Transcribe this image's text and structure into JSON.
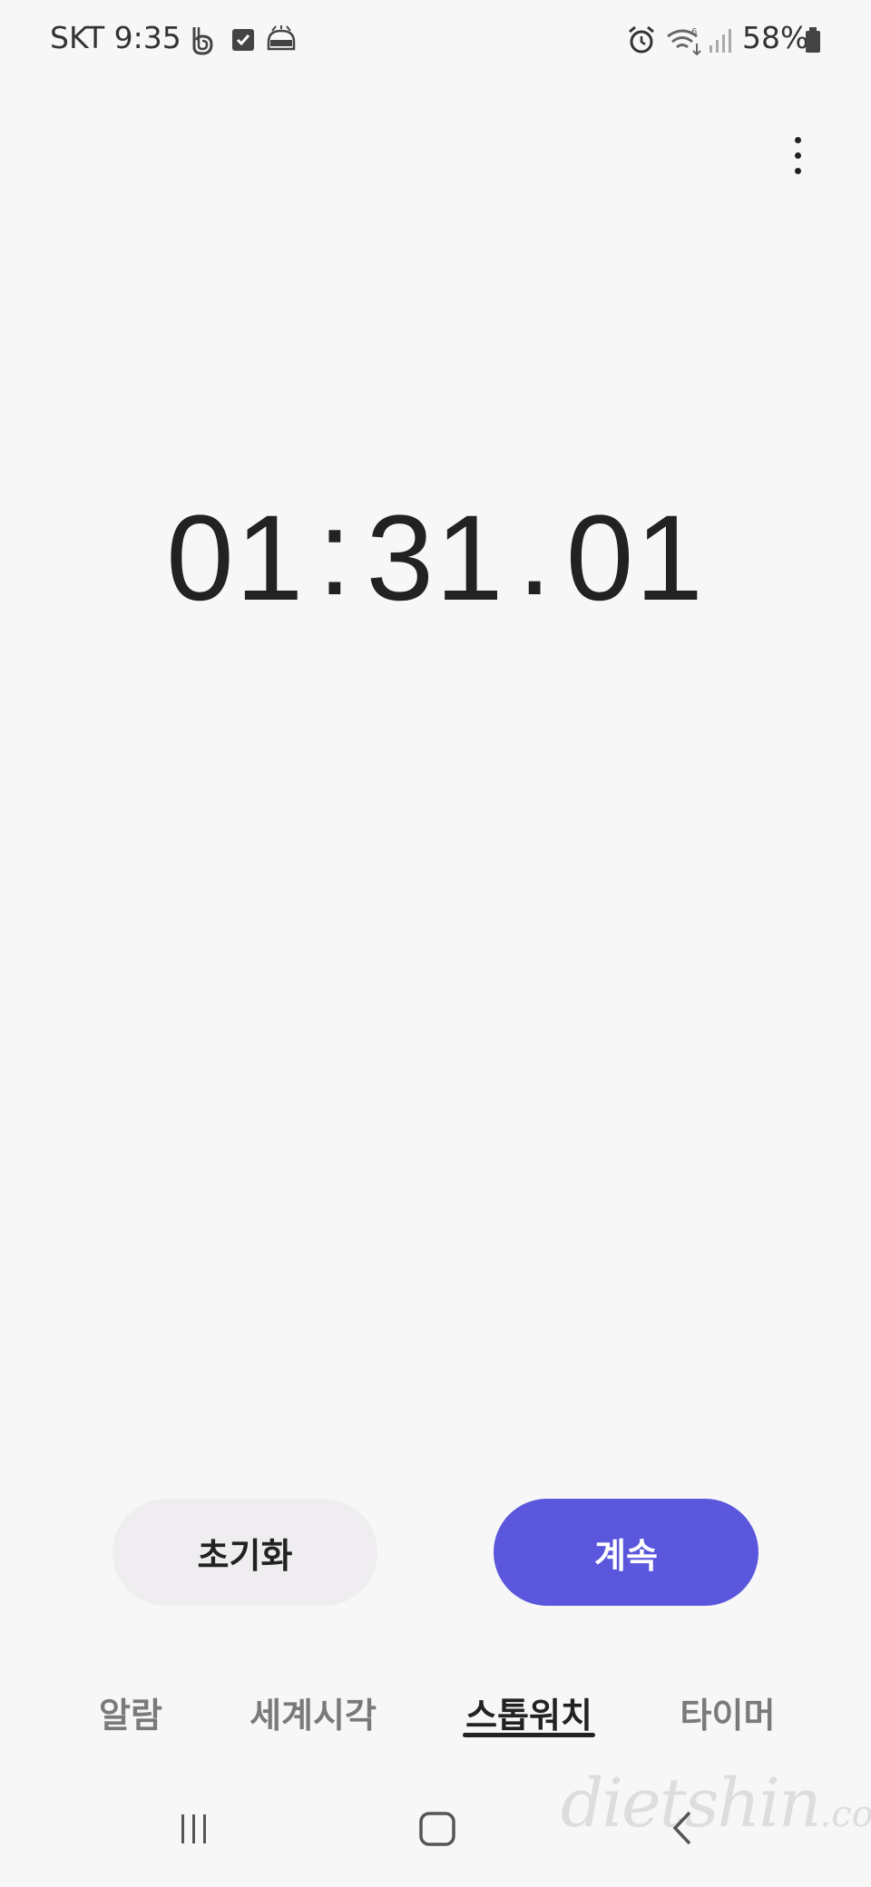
{
  "status_bar": {
    "carrier_time": "SKT 9:35",
    "battery_percent": "58%",
    "icons": [
      "b-app-icon",
      "checkbox-app-icon",
      "dash-app-icon",
      "alarm-icon",
      "wifi-icon",
      "signal-icon",
      "battery-icon"
    ]
  },
  "menu": {
    "icon": "more-vert-icon"
  },
  "stopwatch": {
    "minutes": "01",
    "sep1": ":",
    "seconds": "31",
    "sep2": ".",
    "hundredths": "01"
  },
  "buttons": {
    "reset_label": "초기화",
    "continue_label": "계속"
  },
  "tabs": [
    {
      "label": "알람",
      "active": false
    },
    {
      "label": "세계시각",
      "active": false
    },
    {
      "label": "스톱워치",
      "active": true
    },
    {
      "label": "타이머",
      "active": false
    }
  ],
  "nav": {
    "icons": [
      "recent-apps-icon",
      "home-icon",
      "back-icon"
    ]
  },
  "watermark": {
    "text": "dietshin",
    "suffix": ".com"
  },
  "colors": {
    "background": "#f7f7f7",
    "accent": "#5b57dc",
    "reset_button_bg": "#efedf0"
  }
}
